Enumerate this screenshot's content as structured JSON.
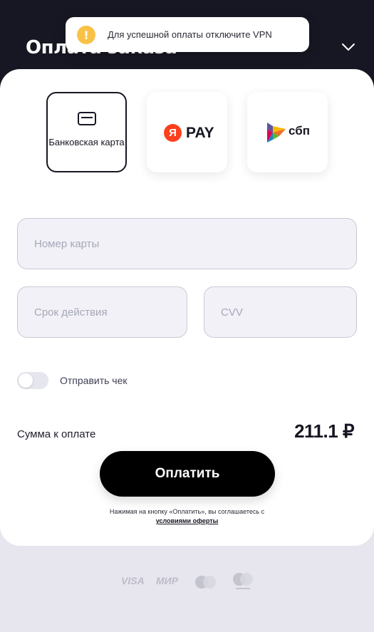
{
  "header": {
    "title": "Оплата заказа"
  },
  "toast": {
    "icon": "!",
    "text": "Для успешной оплаты отключите VPN"
  },
  "methods": {
    "bank_card": {
      "label": "Банковская карта",
      "icon": "credit-card-icon"
    },
    "yandex_pay": {
      "badge": "Я",
      "label": "PAY"
    },
    "sbp": {
      "label": "сбп"
    }
  },
  "fields": {
    "card_number": {
      "placeholder": "Номер карты",
      "value": ""
    },
    "expiry": {
      "placeholder": "Срок действия",
      "value": ""
    },
    "cvv": {
      "placeholder": "CVV",
      "value": ""
    }
  },
  "receipt": {
    "label": "Отправить чек",
    "enabled": false
  },
  "total": {
    "label": "Сумма к оплате",
    "amount": "211.1 ₽"
  },
  "pay_button": {
    "label": "Оплатить"
  },
  "terms": {
    "text": "Нажимая на кнопку «Оплатить», вы соглашаетесь с ",
    "link": "условиями оферты"
  },
  "footer_logos": {
    "visa": "VISA",
    "mir": "МИР"
  },
  "colors": {
    "header_bg": "#161722",
    "accent_yandex": "#fc3f1d",
    "warning": "#f8c247",
    "button_bg": "#000000"
  }
}
